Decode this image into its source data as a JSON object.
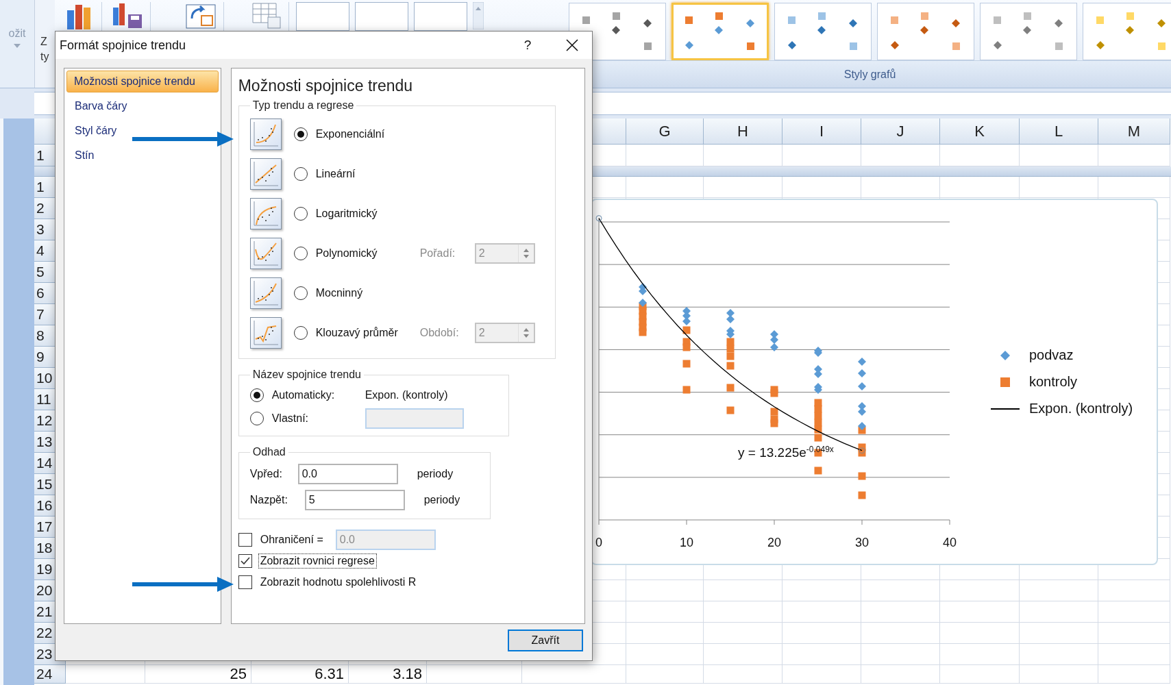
{
  "ribbon": {
    "tab_label": "ožit",
    "cut_button_labels": [
      "Z",
      "ty"
    ],
    "chart_styles": [
      {
        "selected": false
      },
      {
        "selected": true
      },
      {
        "selected": false
      },
      {
        "selected": false
      },
      {
        "selected": false
      },
      {
        "selected": false
      }
    ],
    "group_label": "Styly grafů"
  },
  "sheet": {
    "columns": [
      "G",
      "H",
      "I",
      "J",
      "K",
      "L",
      "M"
    ],
    "frozen_row": "1",
    "rows": [
      {
        "header": "1"
      },
      {
        "header": "2"
      },
      {
        "header": "3"
      },
      {
        "header": "4"
      },
      {
        "header": "5"
      },
      {
        "header": "6"
      },
      {
        "header": "7"
      },
      {
        "header": "8"
      },
      {
        "header": "9"
      },
      {
        "header": "10"
      },
      {
        "header": "11"
      },
      {
        "header": "12"
      },
      {
        "header": "13"
      },
      {
        "header": "14"
      },
      {
        "header": "15"
      },
      {
        "header": "16"
      },
      {
        "header": "17"
      },
      {
        "header": "18"
      },
      {
        "header": "19"
      },
      {
        "header": "20"
      },
      {
        "header": "21"
      },
      {
        "header": "22"
      },
      {
        "header": "23"
      },
      {
        "header": "24",
        "cells": [
          "25",
          "6.31",
          "3.18"
        ]
      }
    ]
  },
  "chart": {
    "x_tick_labels": [
      "0",
      "10",
      "20",
      "30",
      "40"
    ],
    "equation": "y = 13.225e$^{-0.049x}$",
    "legend": [
      {
        "kind": "diamond",
        "label": "podvaz",
        "color": "#5b9bd5"
      },
      {
        "kind": "square",
        "label": "kontroly",
        "color": "#ed7d31"
      },
      {
        "kind": "line",
        "label": "Expon. (kontroly)",
        "color": "#000000"
      }
    ]
  },
  "dialog": {
    "title": "Formát spojnice trendu",
    "help": "?",
    "nav": [
      {
        "label": "Možnosti spojnice trendu",
        "selected": true
      },
      {
        "label": "Barva čáry",
        "selected": false
      },
      {
        "label": "Styl čáry",
        "selected": false
      },
      {
        "label": "Stín",
        "selected": false
      }
    ],
    "heading": "Možnosti spojnice trendu",
    "trend_group": {
      "legend": "Typ trendu a regrese",
      "options": [
        {
          "kind": "exponential",
          "label": "Exponenciální",
          "selected": true
        },
        {
          "kind": "linear",
          "label": "Lineární",
          "selected": false
        },
        {
          "kind": "logarithmic",
          "label": "Logaritmický",
          "selected": false
        },
        {
          "kind": "polynomial",
          "label": "Polynomický",
          "selected": false,
          "spinner": {
            "label": "Pořadí:",
            "value": "2",
            "disabled": true
          }
        },
        {
          "kind": "power",
          "label": "Mocninný",
          "selected": false
        },
        {
          "kind": "moving_average",
          "label": "Klouzavý průměr",
          "selected": false,
          "spinner": {
            "label": "Období:",
            "value": "2",
            "disabled": true
          }
        }
      ]
    },
    "name_group": {
      "legend": "Název spojnice trendu",
      "options": [
        {
          "label": "Automaticky:",
          "selected": true,
          "text": "Expon. (kontroly)"
        },
        {
          "label": "Vlastní:",
          "selected": false,
          "field": {
            "disabled": true
          }
        }
      ]
    },
    "forecast_group": {
      "legend": "Odhad",
      "rows": [
        {
          "label": "Vpřed:",
          "value": "0.0",
          "unit": "periody"
        },
        {
          "label": "Nazpět:",
          "value": "5",
          "unit": "periody"
        }
      ]
    },
    "checkboxes": [
      {
        "label": "Ohraničení =",
        "checked": false,
        "focused": false,
        "field": {
          "value": "0.0",
          "disabled": true
        }
      },
      {
        "label": "Zobrazit rovnici regrese",
        "checked": true,
        "focused": true
      },
      {
        "label": "Zobrazit hodnotu spolehlivosti R",
        "checked": false,
        "focused": false
      }
    ],
    "close_button": "Zavřít"
  }
}
